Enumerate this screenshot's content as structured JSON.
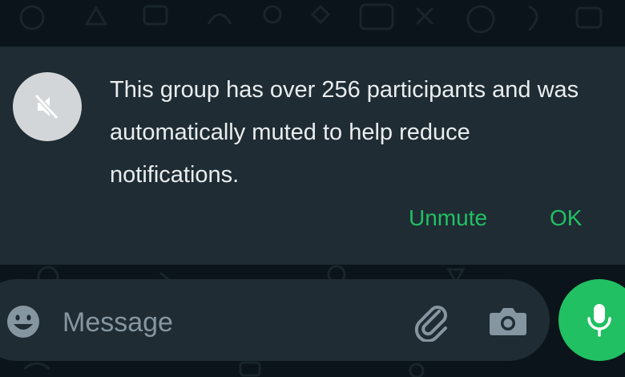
{
  "banner": {
    "icon": "speaker-muted-icon",
    "text": "This group has over 256 participants and was automatically muted to help reduce notifications.",
    "unmute_label": "Unmute",
    "ok_label": "OK"
  },
  "composer": {
    "placeholder": "Message",
    "icons": [
      "emoji-icon",
      "paperclip-icon",
      "camera-icon",
      "microphone-icon"
    ]
  },
  "colors": {
    "background": "#0b141a",
    "panel": "#1f2c34",
    "accent": "#21c063",
    "text": "#e9edef",
    "muted_text": "#8696a0"
  }
}
